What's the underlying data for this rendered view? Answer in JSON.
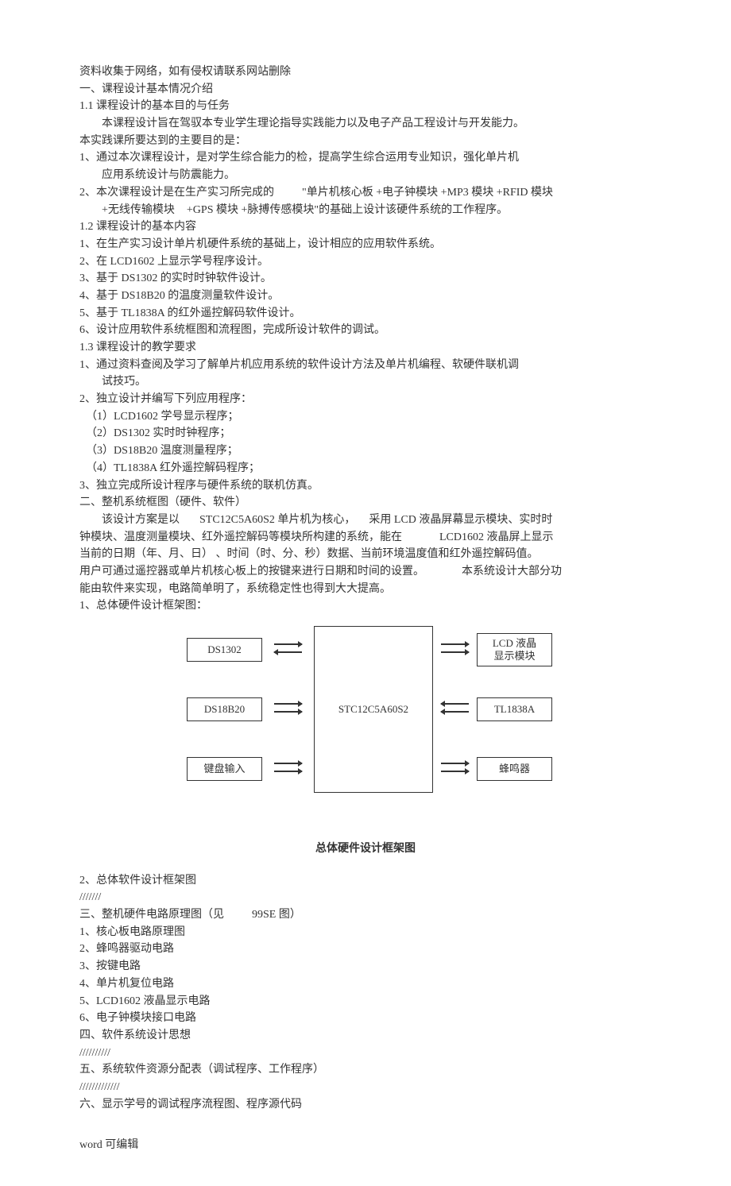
{
  "header_note": "资料收集于网络，如有侵权请联系网站删除",
  "sec1": {
    "h": "一、课程设计基本情况介绍",
    "s1_1": "1.1 课程设计的基本目的与任务",
    "p1": "本课程设计旨在驾驭本专业学生理论指导实践能力以及电子产品工程设计与开发能力。",
    "p1b": "本实践课所要达到的主要目的是：",
    "li1": "1、通过本次课程设计，是对学生综合能力的检，提高学生综合运用专业知识，强化单片机",
    "li1b": "应用系统设计与防震能力。",
    "li2": "2、本次课程设计是在生产实习所完成的",
    "li2a": "\"单片机核心板",
    "li2b": " +电子钟模块 +MP3 模块 +RFID 模块",
    "li2c": "+无线传输模块",
    "li2d": "+GPS 模块 +脉搏传感模块\"的基础上设计该硬件系统的工作程序。",
    "s1_2": "1.2 课程设计的基本内容",
    "c1": "1、在生产实习设计单片机硬件系统的基础上，设计相应的应用软件系统。",
    "c2": "2、在 LCD1602 上显示学号程序设计。",
    "c3": "3、基于  DS1302 的实时时钟软件设计。",
    "c4": "4、基于  DS18B20 的温度测量软件设计。",
    "c5": "5、基于  TL1838A  的红外遥控解码软件设计。",
    "c6": "6、设计应用软件系统框图和流程图，完成所设计软件的调试。",
    "s1_3": "1.3 课程设计的教学要求",
    "r1": "1、通过资料查阅及学习了解单片机应用系统的软件设计方法及单片机编程、软硬件联机调",
    "r1b": "试技巧。",
    "r2": "2、独立设计并编写下列应用程序：",
    "r2a": "（1）LCD1602 学号显示程序；",
    "r2b": "（2）DS1302 实时时钟程序；",
    "r2c": "（3）DS18B20 温度测量程序；",
    "r2d": "（4）TL1838A  红外遥控解码程序；",
    "r3": "3、独立完成所设计程序与硬件系统的联机仿真。"
  },
  "sec2": {
    "h": "二、整机系统框图（硬件、软件）",
    "p1a": "该设计方案是以",
    "p1b": "STC12C5A60S2 单片机为核心，",
    "p1c": "采用 LCD 液晶屏幕显示模块、实时时",
    "p2a": "钟模块、温度测量模块、红外遥控解码等模块所构建的系统，能在",
    "p2b": "LCD1602 液晶屏上显示",
    "p3": "当前的日期（年、月、日）  、时间（时、分、秒）数据、当前环境温度值和红外遥控解码值。",
    "p4a": "用户可通过遥控器或单片机核心板上的按键来进行日期和时间的设置。",
    "p4b": "本系统设计大部分功",
    "p5": "能由软件来实现，电路简单明了，系统稳定性也得到大大提高。",
    "h1": "1、总体硬件设计框架图：",
    "diagram": {
      "left": [
        "DS1302",
        "DS18B20",
        "键盘输入"
      ],
      "center": "STC12C5A60S2",
      "right_top_l1": "LCD 液晶",
      "right_top_l2": "显示模块",
      "right_mid": "TL1838A",
      "right_bot": "蜂鸣器",
      "caption": "总体硬件设计框架图"
    },
    "h2": "2、总体软件设计框架图",
    "sl1": "///////"
  },
  "sec3": {
    "h": "三、整机硬件电路原理图（见",
    "hb": "99SE 图）",
    "i1": "1、核心板电路原理图",
    "i2": "2、蜂鸣器驱动电路",
    "i3": "3、按键电路",
    "i4": "4、单片机复位电路",
    "i5": "5、LCD1602 液晶显示电路",
    "i6": "6、电子钟模块接口电路"
  },
  "sec4": {
    "h": "四、软件系统设计思想",
    "sl": "//////////"
  },
  "sec5": {
    "h": "五、系统软件资源分配表（调试程序、工作程序）",
    "sl": "/////////////"
  },
  "sec6": {
    "h": "六、显示学号的调试程序流程图、程序源代码"
  },
  "footer": "word  可编辑"
}
